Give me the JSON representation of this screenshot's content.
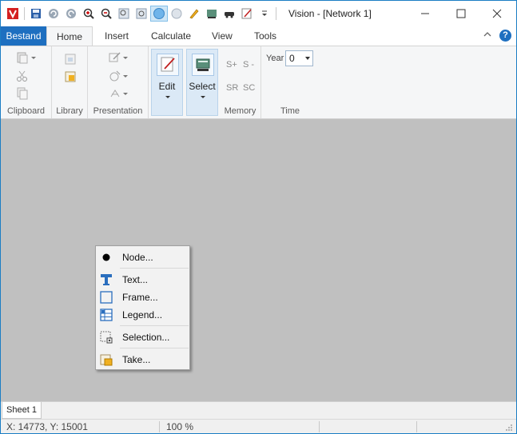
{
  "window": {
    "title": "Vision - [Network 1]",
    "controls": [
      "minimize",
      "maximize",
      "close"
    ]
  },
  "quick_access": [
    "app-logo-icon",
    "save-icon",
    "undo-icon",
    "redo-icon",
    "zoom-in-icon",
    "zoom-out-icon",
    "zoom-window-icon",
    "zoom-fit-icon",
    "sphere-icon",
    "circle-icon",
    "pencil-icon",
    "report-icon",
    "car-icon",
    "edit-note-icon",
    "customize-dropdown-icon"
  ],
  "ribbon": {
    "file_tab": "Bestand",
    "tabs": [
      "Home",
      "Insert",
      "Calculate",
      "View",
      "Tools"
    ],
    "active_tab": "Home",
    "help_label": "?",
    "groups": {
      "clipboard": "Clipboard",
      "library": "Library",
      "presentation": "Presentation",
      "memory": "Memory",
      "time": "Time"
    },
    "edit_label": "Edit",
    "select_label": "Select",
    "memory_buttons": [
      "S+",
      "S -",
      "SR",
      "SC"
    ],
    "year_label": "Year",
    "year_value": "0"
  },
  "context_menu": {
    "items": [
      {
        "label": "Node...",
        "icon": "node-bullet-icon"
      },
      {
        "label": "Text...",
        "icon": "text-icon"
      },
      {
        "label": "Frame...",
        "icon": "frame-icon"
      },
      {
        "label": "Legend...",
        "icon": "legend-icon"
      },
      {
        "label": "Selection...",
        "icon": "selection-icon"
      },
      {
        "label": "Take...",
        "icon": "take-icon"
      }
    ]
  },
  "sheets": [
    "Sheet 1"
  ],
  "status": {
    "coordinates": "X: 14773, Y: 15001",
    "zoom": "100 %"
  },
  "colors": {
    "accent": "#1e6fc0",
    "canvas": "#c0c0c0",
    "ribbon_bg": "#f5f6f7"
  }
}
